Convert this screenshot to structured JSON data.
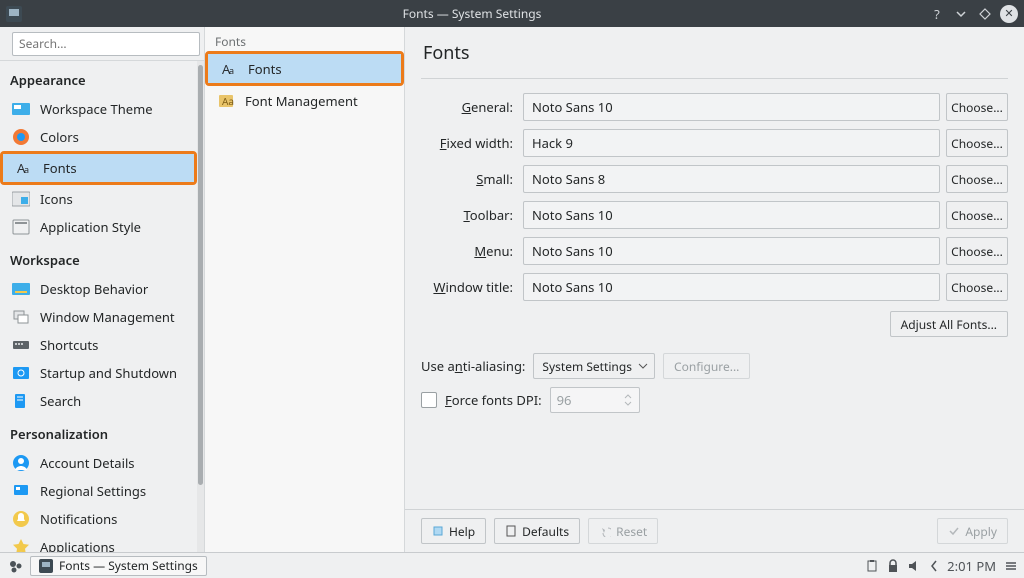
{
  "titlebar": {
    "title": "Fonts — System Settings"
  },
  "search": {
    "placeholder": "Search..."
  },
  "sidebar": {
    "groups": [
      {
        "title": "Appearance",
        "items": [
          {
            "label": "Workspace Theme",
            "name": "workspace-theme"
          },
          {
            "label": "Colors",
            "name": "colors"
          },
          {
            "label": "Fonts",
            "name": "fonts",
            "selected": true
          },
          {
            "label": "Icons",
            "name": "icons"
          },
          {
            "label": "Application Style",
            "name": "application-style"
          }
        ]
      },
      {
        "title": "Workspace",
        "items": [
          {
            "label": "Desktop Behavior",
            "name": "desktop-behavior"
          },
          {
            "label": "Window Management",
            "name": "window-management"
          },
          {
            "label": "Shortcuts",
            "name": "shortcuts"
          },
          {
            "label": "Startup and Shutdown",
            "name": "startup-shutdown"
          },
          {
            "label": "Search",
            "name": "search"
          }
        ]
      },
      {
        "title": "Personalization",
        "items": [
          {
            "label": "Account Details",
            "name": "account-details"
          },
          {
            "label": "Regional Settings",
            "name": "regional-settings"
          },
          {
            "label": "Notifications",
            "name": "notifications"
          },
          {
            "label": "Applications",
            "name": "applications"
          }
        ]
      }
    ]
  },
  "subpanel": {
    "title": "Fonts",
    "items": [
      {
        "label": "Fonts",
        "name": "fonts",
        "selected": true
      },
      {
        "label": "Font Management",
        "name": "font-management"
      }
    ]
  },
  "page": {
    "title": "Fonts",
    "rows": [
      {
        "label_pre": "",
        "label_u": "G",
        "label_post": "eneral:",
        "value": "Noto Sans 10",
        "choose": "Choose..."
      },
      {
        "label_pre": "",
        "label_u": "F",
        "label_post": "ixed width:",
        "value": "Hack  9",
        "choose": "Choose..."
      },
      {
        "label_pre": "",
        "label_u": "S",
        "label_post": "mall:",
        "value": "Noto Sans 8",
        "choose": "Choose..."
      },
      {
        "label_pre": "",
        "label_u": "T",
        "label_post": "oolbar:",
        "value": "Noto Sans 10",
        "choose": "Choose..."
      },
      {
        "label_pre": "",
        "label_u": "M",
        "label_post": "enu:",
        "value": "Noto Sans 10",
        "choose": "Choose..."
      },
      {
        "label_pre": "",
        "label_u": "W",
        "label_post": "indow title:",
        "value": "Noto Sans 10",
        "choose": "Choose..."
      }
    ],
    "adjust_all": "Adjust All Fonts...",
    "aa_label_pre": "Use a",
    "aa_label_u": "n",
    "aa_label_post": "ti-aliasing:",
    "aa_value": "System Settings",
    "configure": "Configure...",
    "dpi_label_pre": "",
    "dpi_label_u": "F",
    "dpi_label_post": "orce fonts DPI:",
    "dpi_value": "96",
    "footer": {
      "help": "Help",
      "defaults": "Defaults",
      "reset": "Reset",
      "apply": "Apply"
    }
  },
  "taskbar": {
    "task": "Fonts  — System Settings",
    "clock": "2:01 PM"
  }
}
